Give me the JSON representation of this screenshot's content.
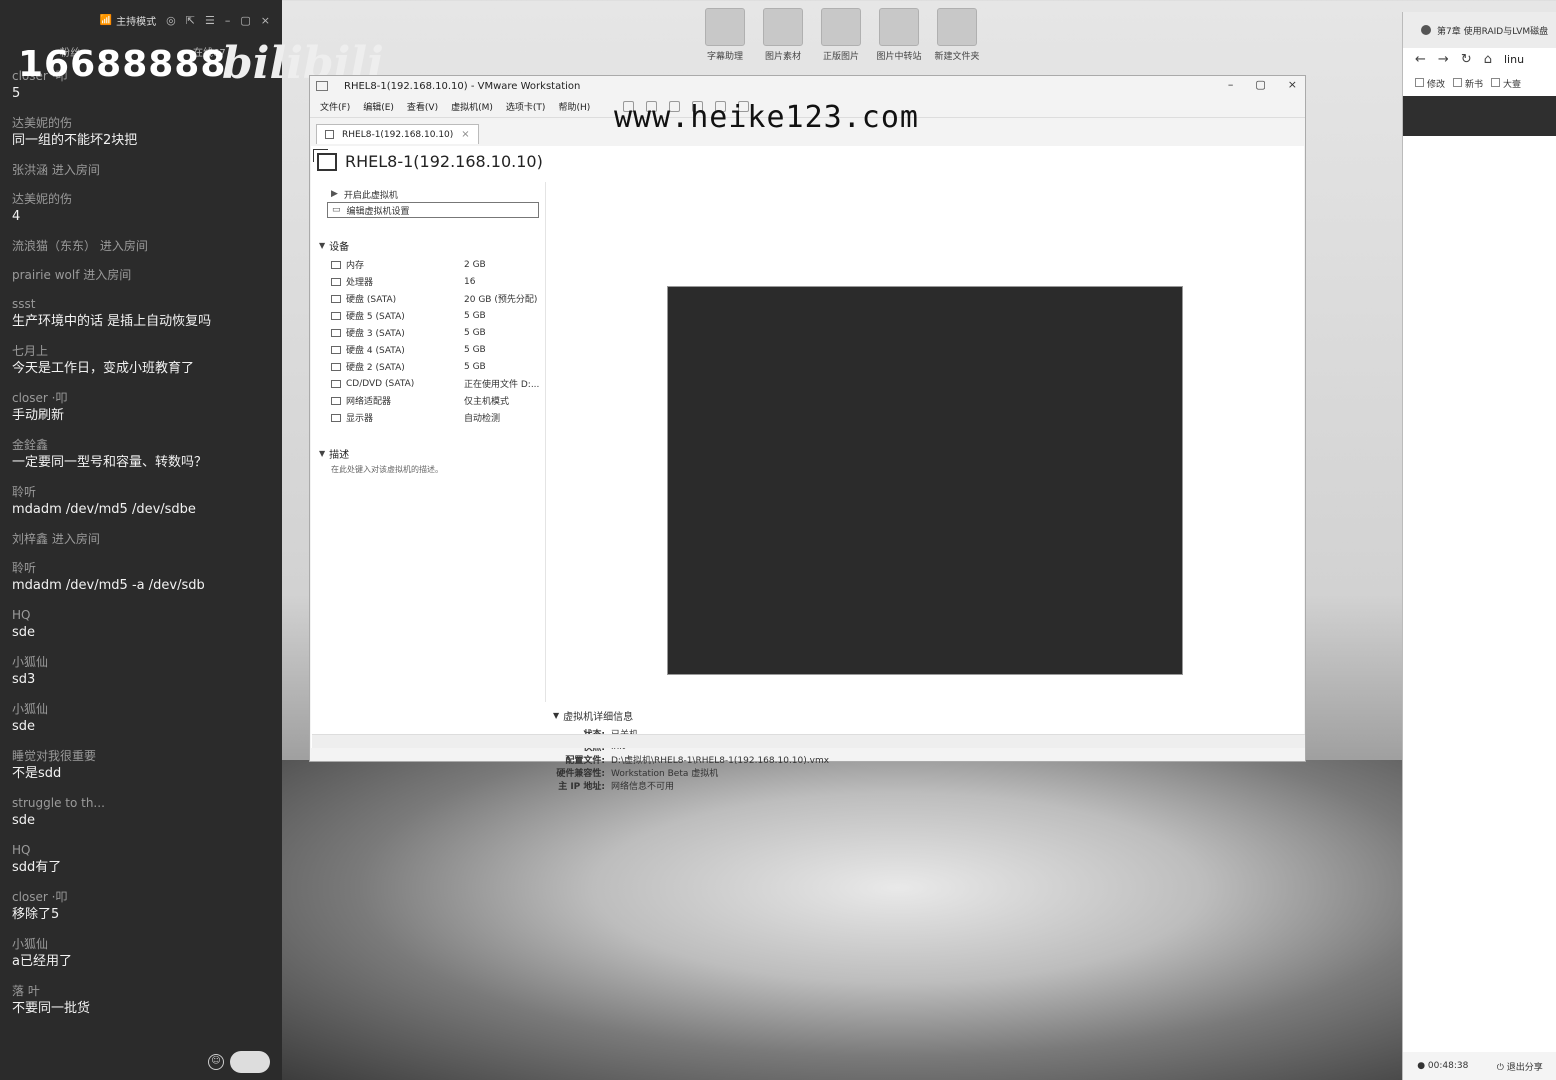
{
  "desktop": {
    "icons": [
      "字幕助理",
      "图片素材",
      "正版图片",
      "图片中转站",
      "新建文件夹"
    ]
  },
  "chat": {
    "mode_label": "主持模式",
    "fans_label": "粉丝",
    "online_label": "在线67",
    "watermark_number": "16688888",
    "watermark_logo": "bilibili",
    "messages": [
      {
        "name": "closer ·叩",
        "text": "5"
      },
      {
        "name": "达美妮的伤",
        "text": "同一组的不能坏2块把"
      },
      {
        "name": "张洪涵 进入房间",
        "text": ""
      },
      {
        "name": "达美妮的伤",
        "text": "4"
      },
      {
        "name": "流浪猫（东东） 进入房间",
        "text": ""
      },
      {
        "name": "prairie wolf 进入房间",
        "text": ""
      },
      {
        "name": "ssst",
        "text": "生产环境中的话 是插上自动恢复吗"
      },
      {
        "name": "七月上",
        "text": "今天是工作日，变成小班教育了"
      },
      {
        "name": "closer ·叩",
        "text": "手动刷新"
      },
      {
        "name": "金銓鑫",
        "text": "一定要同一型号和容量、转数吗？"
      },
      {
        "name": "聆听",
        "text": "mdadm /dev/md5 /dev/sdbe"
      },
      {
        "name": "刘梓鑫 进入房间",
        "text": ""
      },
      {
        "name": "聆听",
        "text": "mdadm /dev/md5 -a /dev/sdb"
      },
      {
        "name": "HQ",
        "text": "sde"
      },
      {
        "name": "小狐仙",
        "text": "sd3"
      },
      {
        "name": "小狐仙",
        "text": "sde"
      },
      {
        "name": "睡觉对我很重要",
        "text": "不是sdd"
      },
      {
        "name": "struggle to th...",
        "text": "sde"
      },
      {
        "name": "HQ",
        "text": "sdd有了"
      },
      {
        "name": "closer ·叩",
        "text": "移除了5"
      },
      {
        "name": "小狐仙",
        "text": "a已经用了"
      },
      {
        "name": "落 叶",
        "text": "不要同一批货"
      }
    ]
  },
  "vmware": {
    "window_title": "RHEL8-1(192.168.10.10) - VMware Workstation",
    "watermark_url": "www.heike123.com",
    "menu": [
      "文件(F)",
      "编辑(E)",
      "查看(V)",
      "虚拟机(M)",
      "选项卡(T)",
      "帮助(H)"
    ],
    "tab_label": "RHEL8-1(192.168.10.10)",
    "vm_title": "RHEL8-1(192.168.10.10)",
    "actions": {
      "power_on": "开启此虚拟机",
      "edit_settings": "编辑虚拟机设置"
    },
    "devices_header": "设备",
    "devices": [
      {
        "name": "内存",
        "value": "2 GB"
      },
      {
        "name": "处理器",
        "value": "16"
      },
      {
        "name": "硬盘 (SATA)",
        "value": "20 GB (预先分配)"
      },
      {
        "name": "硬盘 5 (SATA)",
        "value": "5 GB"
      },
      {
        "name": "硬盘 3 (SATA)",
        "value": "5 GB"
      },
      {
        "name": "硬盘 4 (SATA)",
        "value": "5 GB"
      },
      {
        "name": "硬盘 2 (SATA)",
        "value": "5 GB"
      },
      {
        "name": "CD/DVD (SATA)",
        "value": "正在使用文件 D:..."
      },
      {
        "name": "网络适配器",
        "value": "仅主机模式"
      },
      {
        "name": "显示器",
        "value": "自动检测"
      }
    ],
    "description_header": "描述",
    "description_hint": "在此处键入对该虚拟机的描述。",
    "details_header": "虚拟机详细信息",
    "details": [
      {
        "key": "状态:",
        "value": "已关机"
      },
      {
        "key": "快照:",
        "value": "init"
      },
      {
        "key": "配置文件:",
        "value": "D:\\虚拟机\\RHEL8-1\\RHEL8-1(192.168.10.10).vmx"
      },
      {
        "key": "硬件兼容性:",
        "value": "Workstation Beta 虚拟机"
      },
      {
        "key": "主 IP 地址:",
        "value": "网络信息不可用"
      }
    ]
  },
  "browser": {
    "tab_title": "第7章 使用RAID与LVM磁盘",
    "address": "linu",
    "bookmarks": [
      "修改",
      "新书",
      "大壹"
    ],
    "time": "00:48:38",
    "exit_share": "退出分享"
  }
}
